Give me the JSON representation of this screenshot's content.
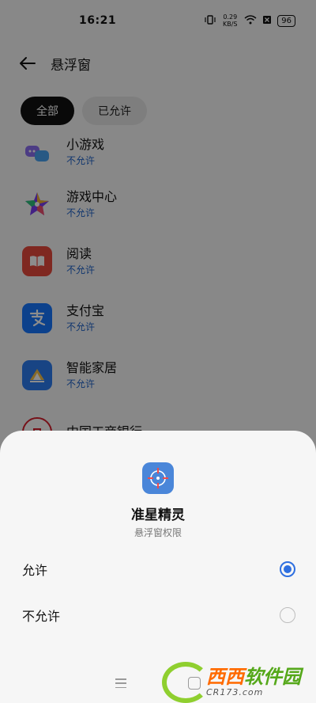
{
  "status_bar": {
    "time": "16:21",
    "network_speed": "0.29 KB/S",
    "battery": "96"
  },
  "header": {
    "title": "悬浮窗",
    "back_icon": "arrow-left-icon"
  },
  "filters": [
    {
      "label": "全部",
      "active": true
    },
    {
      "label": "已允许",
      "active": false
    }
  ],
  "apps": [
    {
      "name": "小游戏",
      "status": "不允许",
      "icon": "mini-games-icon"
    },
    {
      "name": "游戏中心",
      "status": "不允许",
      "icon": "game-center-icon"
    },
    {
      "name": "阅读",
      "status": "不允许",
      "icon": "reading-icon"
    },
    {
      "name": "支付宝",
      "status": "不允许",
      "icon": "alipay-icon"
    },
    {
      "name": "智能家居",
      "status": "不允许",
      "icon": "smart-home-icon"
    },
    {
      "name": "中国工商银行",
      "status": "",
      "icon": "icbc-icon"
    }
  ],
  "sheet": {
    "app_name": "准星精灵",
    "subtitle": "悬浮窗权限",
    "options": [
      {
        "label": "允许",
        "selected": true
      },
      {
        "label": "不允许",
        "selected": false
      }
    ]
  },
  "watermark": {
    "main_orange": "西西",
    "main_green": "软件园",
    "url": "CR173.com"
  },
  "colors": {
    "accent": "#2e6fe0",
    "status_text": "#1f63c9"
  }
}
